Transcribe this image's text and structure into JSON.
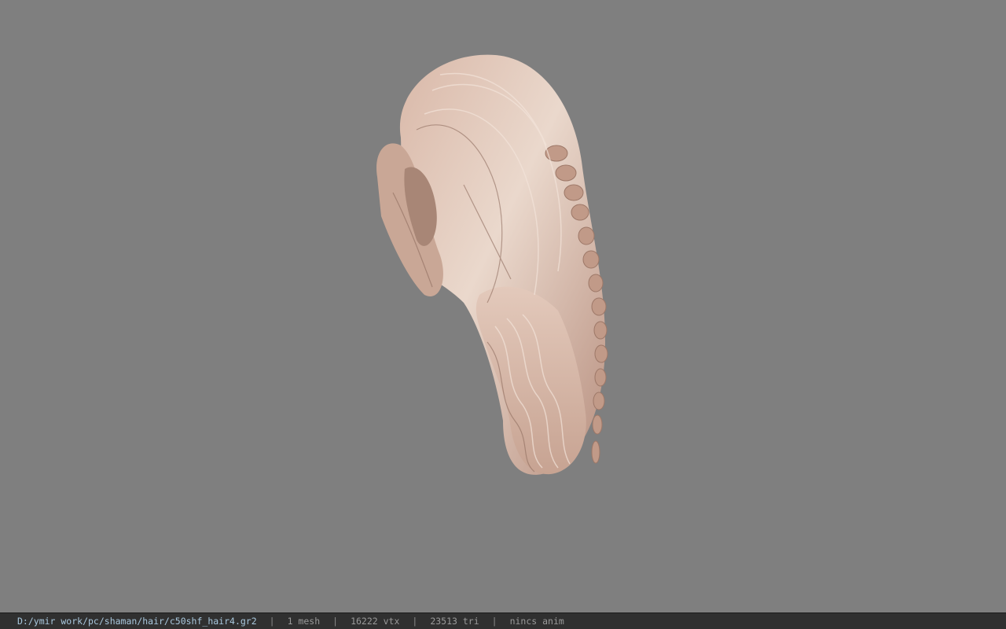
{
  "viewport": {
    "background_color": "#7f7f7f",
    "model_icon": "hair-model-icon",
    "model_colors": {
      "light": "#e8d2c4",
      "mid": "#c9a594",
      "dark": "#8a6a5c"
    }
  },
  "statusbar": {
    "file_path": "D:/ymir work/pc/shaman/hair/c50shf_hair4.gr2",
    "separator": "|",
    "mesh_count": "1 mesh",
    "vertex_count": "16222 vtx",
    "triangle_count": "23513 tri",
    "animation": "nincs anim"
  }
}
